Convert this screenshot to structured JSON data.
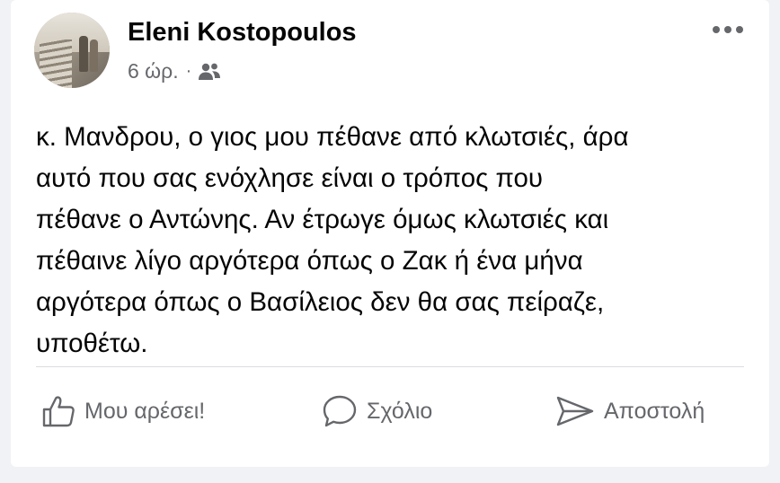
{
  "post": {
    "author": "Eleni Kostopoulos",
    "time": "6 ώρ.",
    "separator": "·",
    "audience_icon": "friends-icon",
    "more_icon": "more-options-icon",
    "text": "κ. Μανδρου, ο γιος μου πέθανε από κλωτσιές, άρα\nαυτό που σας ενόχλησε είναι ο τρόπος που\nπέθανε ο Αντώνης. Αν έτρωγε όμως κλωτσιές και\nπέθαινε λίγο αργότερα όπως ο Ζακ ή ένα μήνα\nαργότερα όπως ο Βασίλειος δεν θα σας πείραζε,\nυποθέτω."
  },
  "actions": {
    "like_label": "Μου αρέσει!",
    "comment_label": "Σχόλιο",
    "share_label": "Αποστολή"
  },
  "colors": {
    "text": "#050505",
    "secondary": "#65676b",
    "divider": "#dadde1"
  }
}
